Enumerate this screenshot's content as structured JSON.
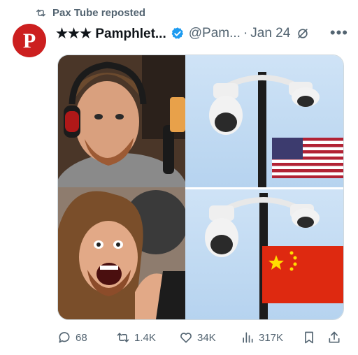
{
  "repost_banner": {
    "text": "Pax Tube reposted"
  },
  "author": {
    "avatar_letter": "P",
    "display_name": "★★★ Pamphlet...",
    "handle": "@Pam...",
    "date": "Jan 24"
  },
  "actions": {
    "replies": "68",
    "reposts": "1.4K",
    "likes": "34K",
    "views": "317K"
  },
  "colors": {
    "avatar_bg": "#cc1f1f",
    "verified_blue": "#1d9bf0",
    "muted_text": "#536471"
  }
}
